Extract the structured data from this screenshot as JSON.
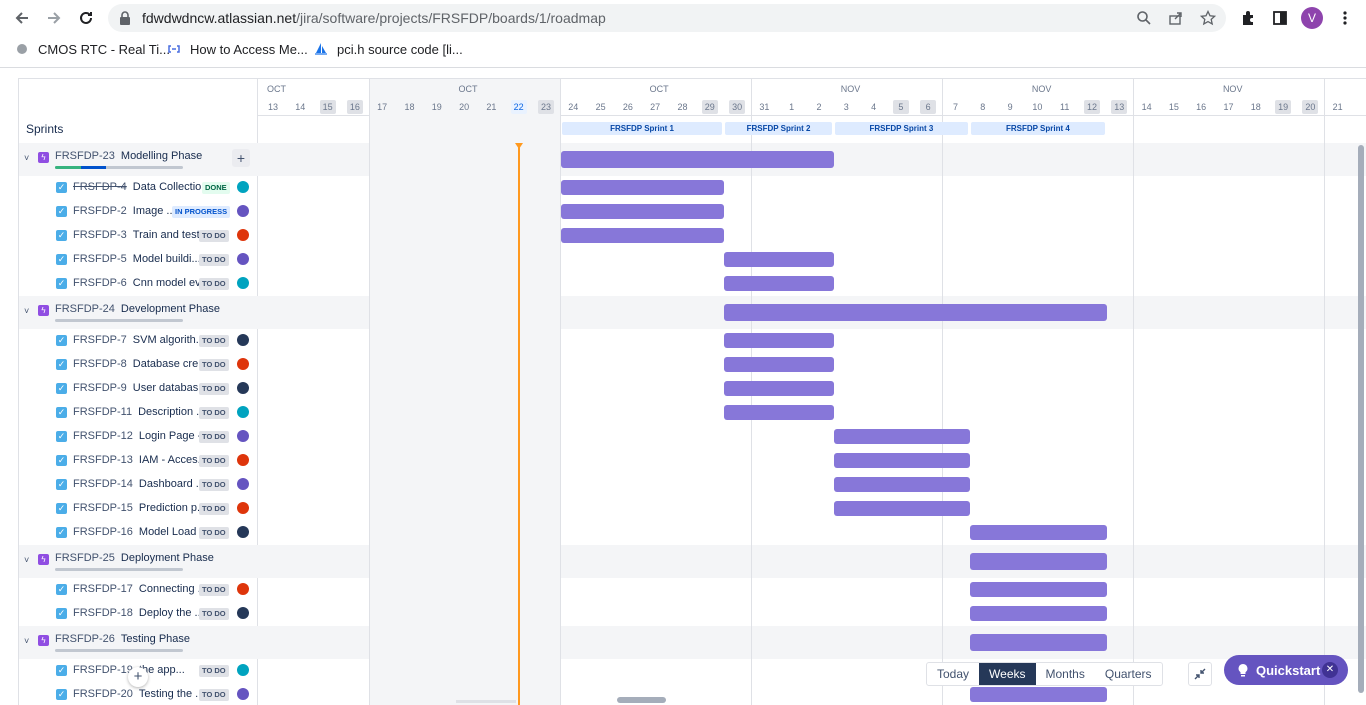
{
  "browser": {
    "url_host": "fdwdwdncw.atlassian.net",
    "url_path": "/jira/software/projects/FRSFDP/boards/1/roadmap",
    "profile_initial": "V",
    "bookmarks": [
      {
        "label": "CMOS RTC - Real Ti...",
        "icon": "chip-icon"
      },
      {
        "label": "How to Access Me...",
        "icon": "link-icon"
      },
      {
        "label": "pci.h source code [li...",
        "icon": "sail-icon"
      }
    ]
  },
  "timeline": {
    "months": [
      "OCT",
      "OCT",
      "OCT",
      "NOV",
      "NOV",
      "NOV",
      "NOV"
    ],
    "days": [
      "13",
      "14",
      "15",
      "16",
      "17",
      "18",
      "19",
      "20",
      "21",
      "22",
      "23",
      "24",
      "25",
      "26",
      "27",
      "28",
      "29",
      "30",
      "31",
      "1",
      "2",
      "3",
      "4",
      "5",
      "6",
      "7",
      "8",
      "9",
      "10",
      "11",
      "12",
      "13",
      "14",
      "15",
      "16",
      "17",
      "18",
      "19",
      "20",
      "21"
    ],
    "weekend_days_index": [
      2,
      3,
      9,
      10,
      16,
      17,
      23,
      24,
      30,
      31,
      37,
      38
    ],
    "today_index": 9,
    "sprints_label": "Sprints",
    "sprints": [
      {
        "label": "FRSFDP Sprint 1",
        "start": 11,
        "end": 17
      },
      {
        "label": "FRSFDP Sprint 2",
        "start": 17,
        "end": 21
      },
      {
        "label": "FRSFDP Sprint 3",
        "start": 21,
        "end": 26
      },
      {
        "label": "FRSFDP Sprint 4",
        "start": 26,
        "end": 31
      }
    ]
  },
  "epics": [
    {
      "key": "FRSFDP-23",
      "title": "Modelling Phase",
      "bar": [
        11,
        21
      ],
      "done_frac": 0.2,
      "inprogress_frac": 0.2,
      "issues": [
        {
          "key": "FRSFDP-4",
          "title": "Data Collectio...",
          "status": "DONE",
          "avatar": "teal",
          "bar": [
            11,
            17
          ]
        },
        {
          "key": "FRSFDP-2",
          "title": "Image ...",
          "status": "IN PROGRESS",
          "avatar": "purple",
          "bar": [
            11,
            17
          ]
        },
        {
          "key": "FRSFDP-3",
          "title": "Train and test...",
          "status": "TO DO",
          "avatar": "red",
          "bar": [
            11,
            17
          ]
        },
        {
          "key": "FRSFDP-5",
          "title": "Model buildi...",
          "status": "TO DO",
          "avatar": "purple",
          "bar": [
            17,
            21
          ]
        },
        {
          "key": "FRSFDP-6",
          "title": "Cnn model ev...",
          "status": "TO DO",
          "avatar": "teal",
          "bar": [
            17,
            21
          ]
        }
      ]
    },
    {
      "key": "FRSFDP-24",
      "title": "Development Phase",
      "bar": [
        17,
        31
      ],
      "done_frac": 0,
      "inprogress_frac": 0,
      "issues": [
        {
          "key": "FRSFDP-7",
          "title": "SVM algorith...",
          "status": "TO DO",
          "avatar": "navy",
          "bar": [
            17,
            21
          ]
        },
        {
          "key": "FRSFDP-8",
          "title": "Database cre...",
          "status": "TO DO",
          "avatar": "red",
          "bar": [
            17,
            21
          ]
        },
        {
          "key": "FRSFDP-9",
          "title": "User databas...",
          "status": "TO DO",
          "avatar": "navy",
          "bar": [
            17,
            21
          ]
        },
        {
          "key": "FRSFDP-11",
          "title": "Description ...",
          "status": "TO DO",
          "avatar": "teal",
          "bar": [
            17,
            21
          ]
        },
        {
          "key": "FRSFDP-12",
          "title": "Login Page -...",
          "status": "TO DO",
          "avatar": "purple",
          "bar": [
            21,
            26
          ]
        },
        {
          "key": "FRSFDP-13",
          "title": "IAM - Acces...",
          "status": "TO DO",
          "avatar": "red",
          "bar": [
            21,
            26
          ]
        },
        {
          "key": "FRSFDP-14",
          "title": "Dashboard ...",
          "status": "TO DO",
          "avatar": "purple",
          "bar": [
            21,
            26
          ]
        },
        {
          "key": "FRSFDP-15",
          "title": "Prediction p...",
          "status": "TO DO",
          "avatar": "red",
          "bar": [
            21,
            26
          ]
        },
        {
          "key": "FRSFDP-16",
          "title": "Model Load ...",
          "status": "TO DO",
          "avatar": "navy",
          "bar": [
            26,
            31
          ]
        }
      ]
    },
    {
      "key": "FRSFDP-25",
      "title": "Deployment Phase",
      "bar": [
        26,
        31
      ],
      "done_frac": 0,
      "inprogress_frac": 0,
      "issues": [
        {
          "key": "FRSFDP-17",
          "title": "Connecting ...",
          "status": "TO DO",
          "avatar": "red",
          "bar": [
            26,
            31
          ]
        },
        {
          "key": "FRSFDP-18",
          "title": "Deploy the ...",
          "status": "TO DO",
          "avatar": "navy",
          "bar": [
            26,
            31
          ]
        }
      ]
    },
    {
      "key": "FRSFDP-26",
      "title": "Testing Phase",
      "bar": [
        26,
        31
      ],
      "done_frac": 0,
      "inprogress_frac": 0,
      "issues": [
        {
          "key": "FRSFDP-19",
          "title": "the app...",
          "status": "TO DO",
          "avatar": "teal",
          "bar": [
            26,
            31
          ]
        },
        {
          "key": "FRSFDP-20",
          "title": "Testing the ...",
          "status": "TO DO",
          "avatar": "purple",
          "bar": [
            26,
            31
          ]
        }
      ]
    }
  ],
  "controls": {
    "view_options": [
      "Today",
      "Weeks",
      "Months",
      "Quarters"
    ],
    "active_view": "Weeks",
    "quickstart_label": "Quickstart"
  },
  "colors": {
    "bar": "#8777d9",
    "today_line": "#ff991f",
    "epic_icon": "#904ee2",
    "story_checkbox": "#4bade8",
    "avatar_teal": "#00a3bf",
    "avatar_purple": "#6554c0",
    "avatar_red": "#de350b",
    "avatar_navy": "#253858"
  }
}
